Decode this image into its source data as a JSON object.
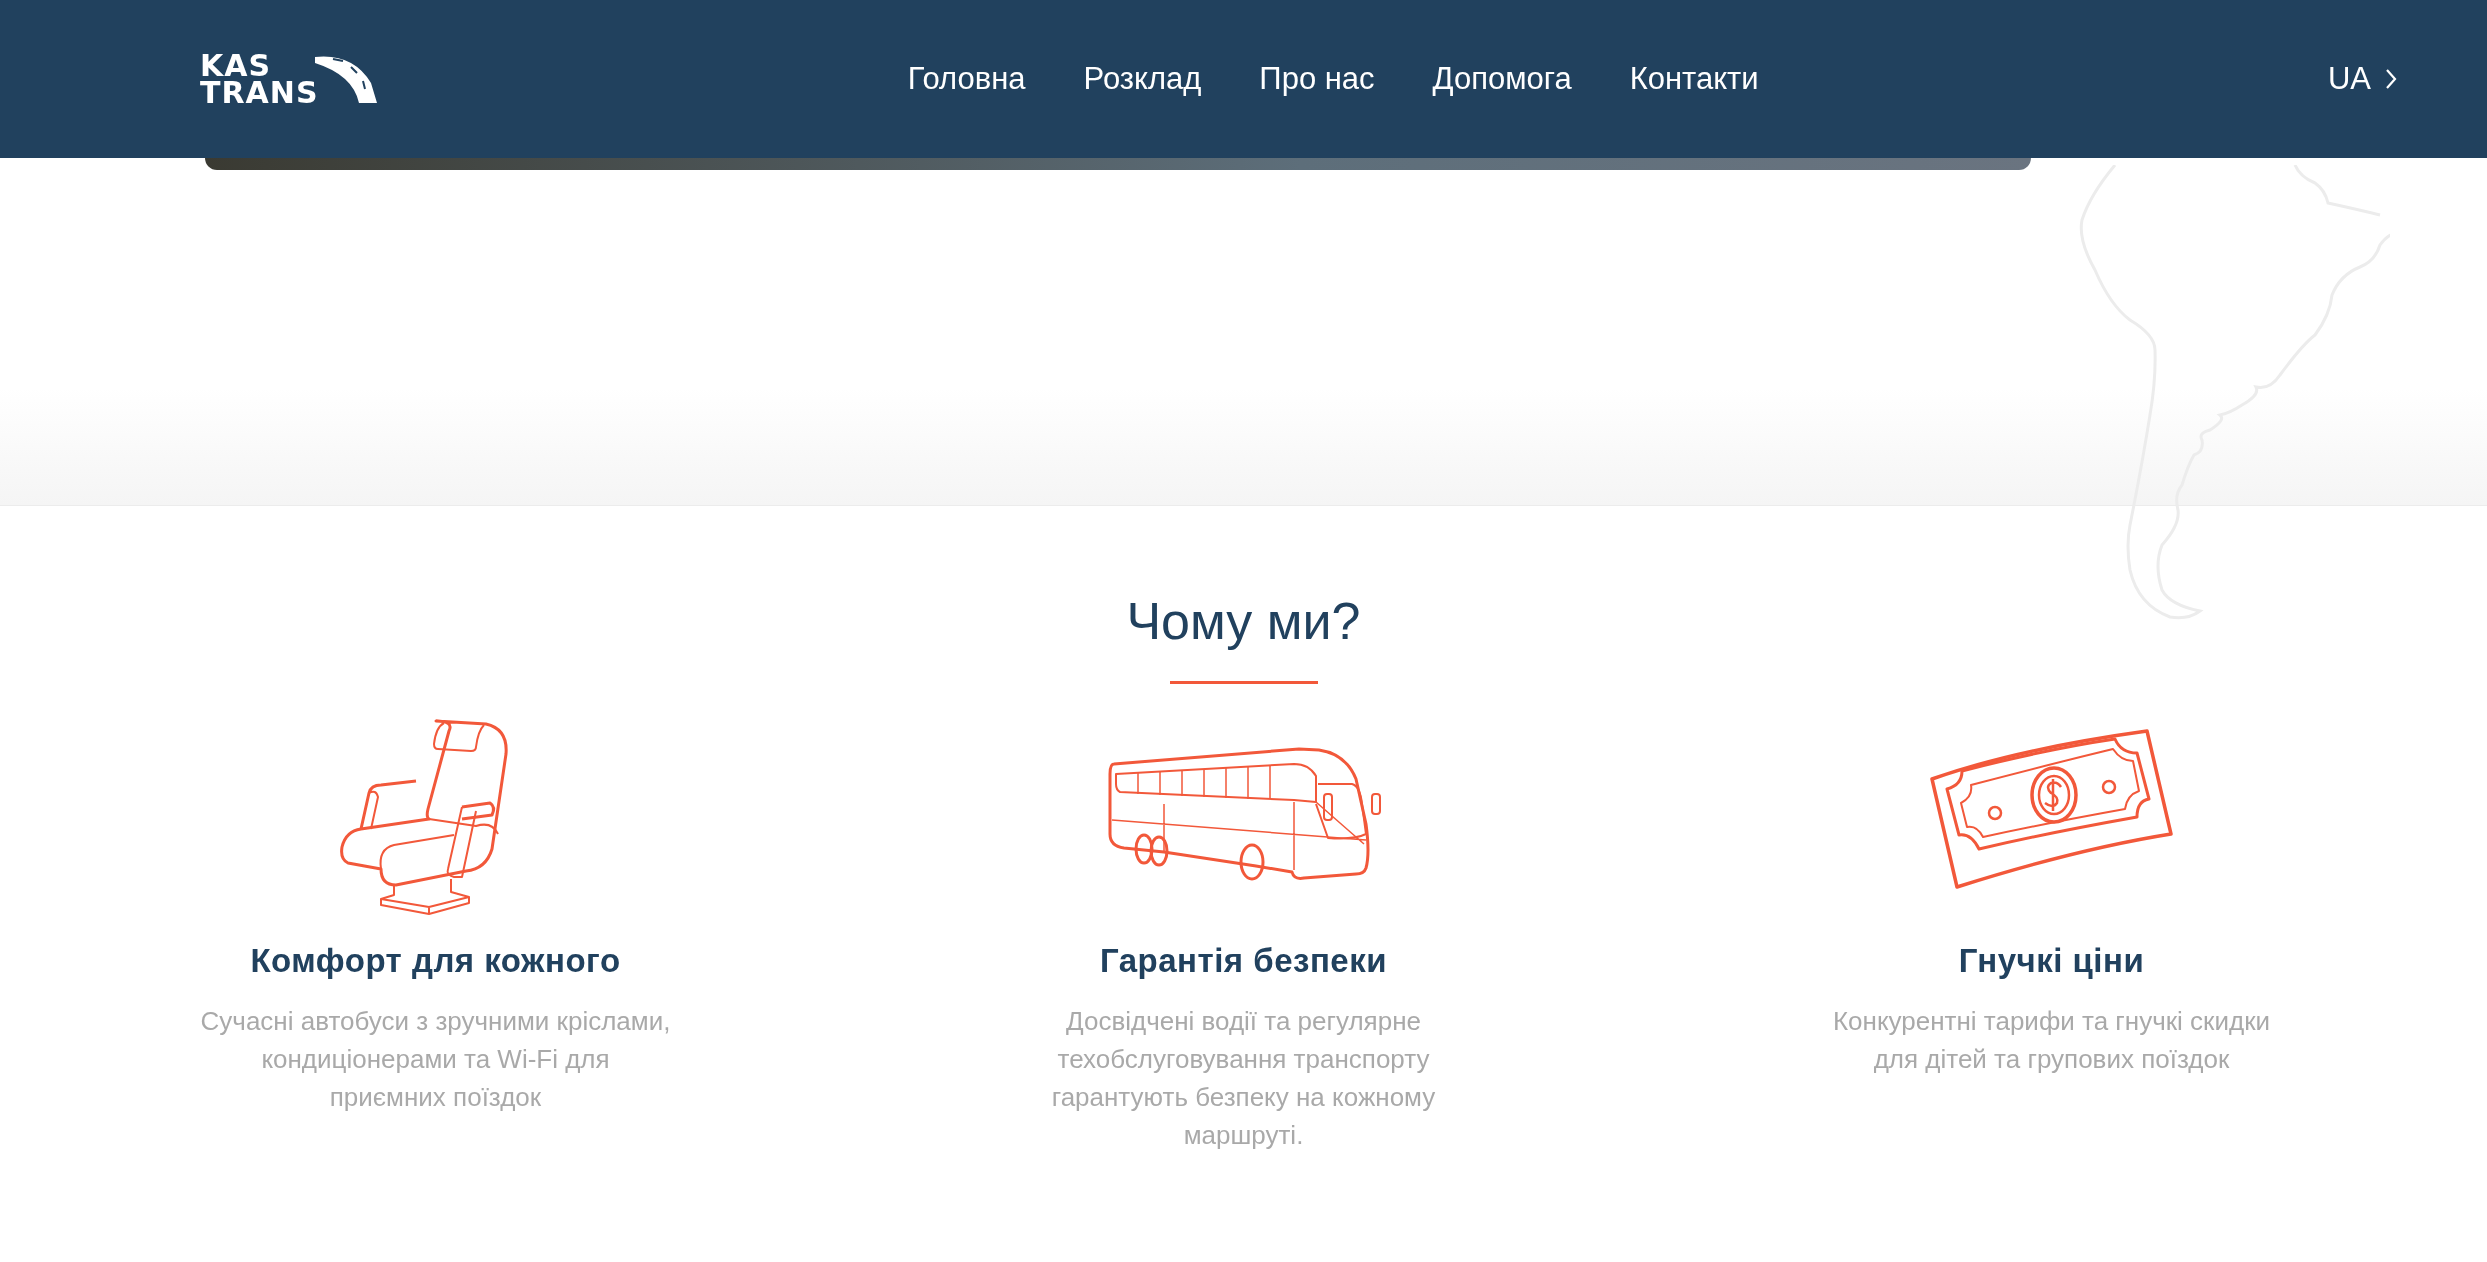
{
  "header": {
    "logo": {
      "line_1": "KAS",
      "line_2": "TRANS"
    },
    "nav": [
      {
        "label": "Головна"
      },
      {
        "label": "Розклад"
      },
      {
        "label": "Про нас"
      },
      {
        "label": "Допомога"
      },
      {
        "label": "Контакти"
      }
    ],
    "language": "UA"
  },
  "why_us": {
    "title": "Чому ми?",
    "features": [
      {
        "kind": "seat",
        "title": "Комфорт для кожного",
        "text": "Сучасні автобуси з зручними кріслами, кондиціонерами та Wi-Fi для приємних поїздок"
      },
      {
        "kind": "bus",
        "title": "Гарантія безпеки",
        "text": "Досвідчені водії та регулярне техобслуговування транспорту гарантують безпеку на кожному маршруті."
      },
      {
        "kind": "money",
        "title": "Гнучкі ціни",
        "text": "Конкурентні тарифи та гнучкі скидки для дітей та групових поїздок"
      }
    ]
  }
}
